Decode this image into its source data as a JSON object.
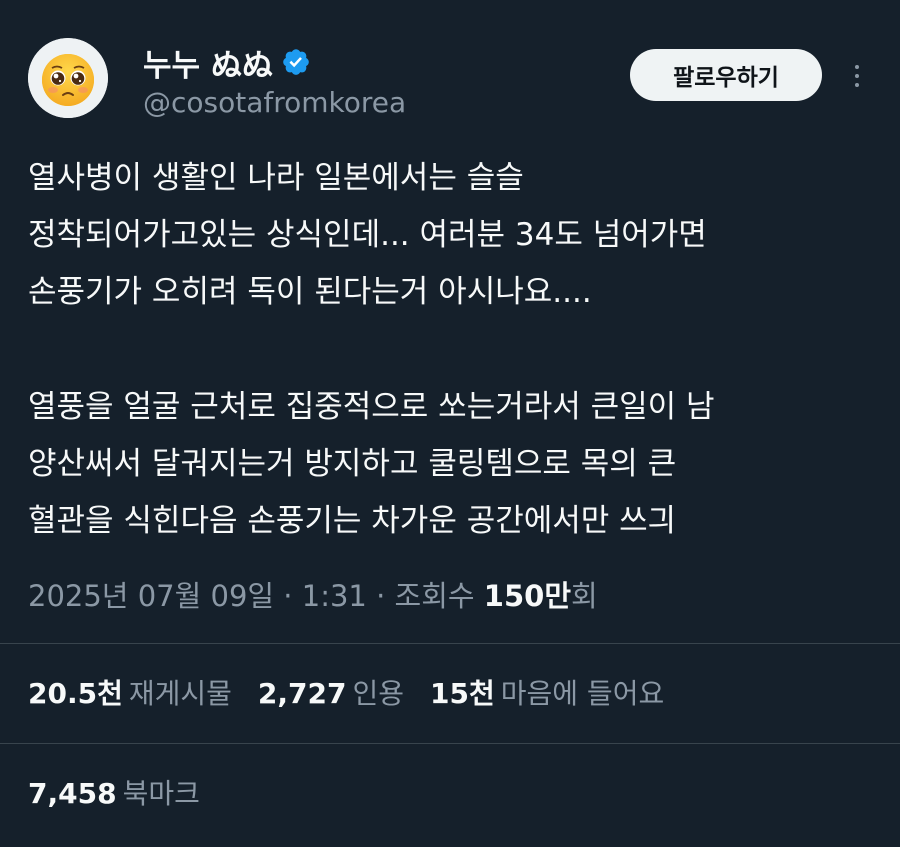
{
  "author": {
    "display_name": "누누 ぬぬ",
    "handle": "@cosotafromkorea",
    "avatar_icon": "pleading-face-emoji",
    "verified_color": "#1d9bf0"
  },
  "actions": {
    "follow_label": "팔로우하기",
    "more_icon": "more-vertical-icon"
  },
  "post": {
    "lines": [
      "열사병이 생활인 나라 일본에서는 슬슬",
      "정착되어가고있는 상식인데... 여러분 34도 넘어가면",
      "손풍기가 오히려 독이 된다는거 아시나요....",
      "",
      "열풍을 얼굴 근처로 집중적으로 쏘는거라서 큰일이 남",
      "양산써서 달궈지는거 방지하고 쿨링템으로 목의 큰",
      "혈관을 식힌다음  손풍기는 차가운 공간에서만 쓰긔"
    ]
  },
  "meta": {
    "date": "2025년 07월 09일",
    "separator": " · ",
    "time": "1:31",
    "views_label": "조회수",
    "views_count": "150만",
    "views_suffix": "회"
  },
  "stats": {
    "reposts": {
      "num": "20.5천",
      "label": "재게시물"
    },
    "quotes": {
      "num": "2,727",
      "label": "인용"
    },
    "likes": {
      "num": "15천",
      "label": "마음에 들어요"
    },
    "bookmarks": {
      "num": "7,458",
      "label": "북마크"
    }
  },
  "colors": {
    "background": "#15202b",
    "text": "#f7f9f9",
    "secondary": "#8b98a5",
    "divider": "#38444d"
  }
}
